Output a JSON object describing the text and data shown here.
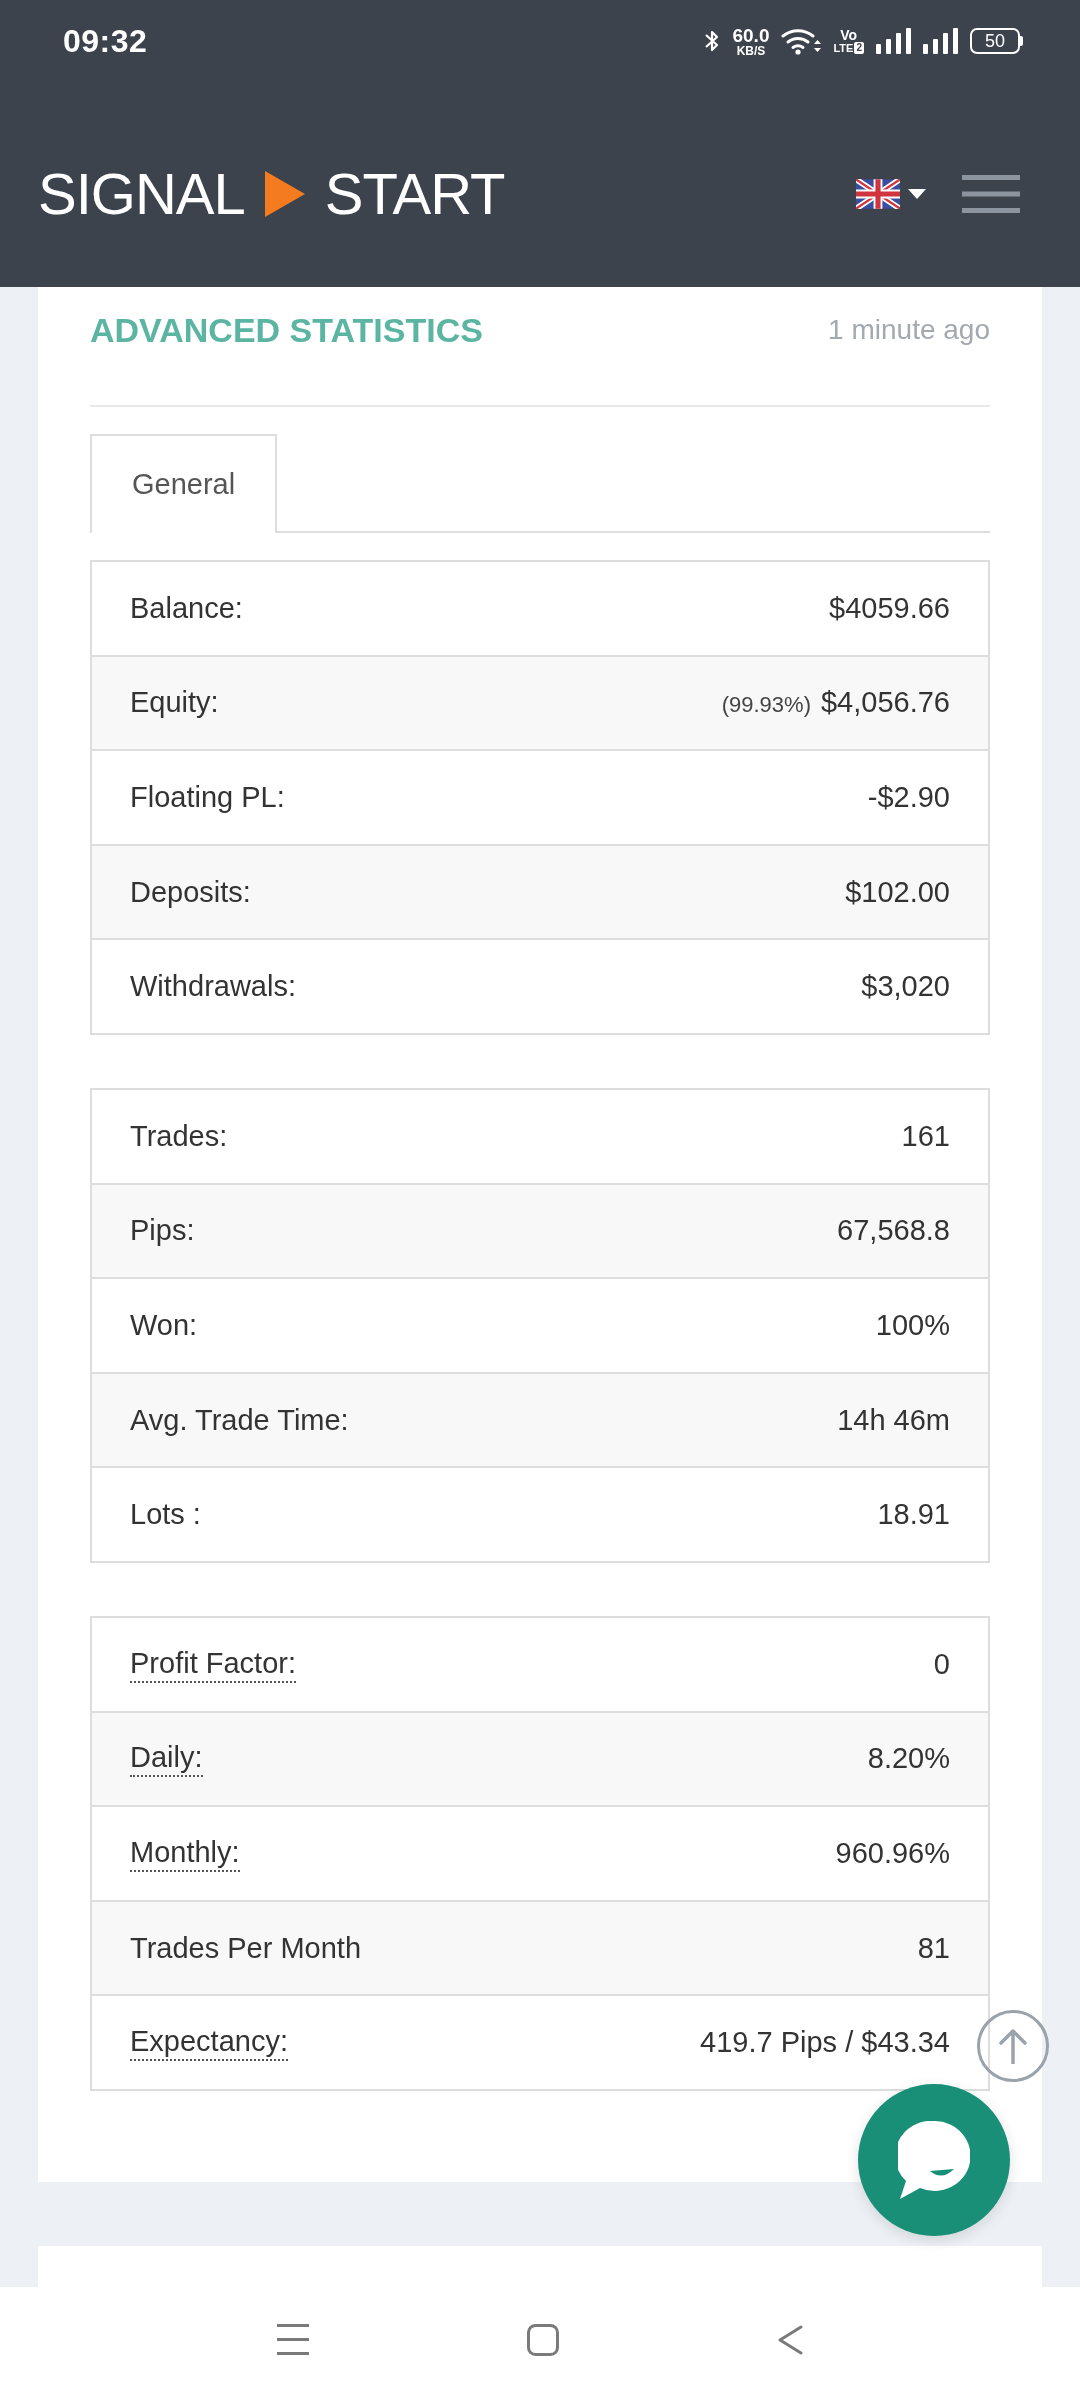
{
  "status_bar": {
    "time": "09:32",
    "network_speed": {
      "value": "60.0",
      "unit": "KB/S"
    },
    "volte": {
      "top": "Vo",
      "bottom": "LTE",
      "sim": "2"
    },
    "battery": "50"
  },
  "header": {
    "logo": {
      "left": "SIGNAL",
      "right": "START"
    }
  },
  "statistics": {
    "title": "ADVANCED STATISTICS",
    "updated": "1 minute ago",
    "tabs": [
      {
        "label": "General",
        "selected": true
      }
    ],
    "tables": [
      {
        "rows": [
          {
            "label": "Balance:",
            "value": "$4059.66",
            "has_tooltip": false
          },
          {
            "label": "Equity:",
            "note": "(99.93%)",
            "value": "$4,056.76",
            "has_tooltip": false
          },
          {
            "label": "Floating PL:",
            "value": "-$2.90",
            "has_tooltip": false
          },
          {
            "label": "Deposits:",
            "value": "$102.00",
            "has_tooltip": false
          },
          {
            "label": "Withdrawals:",
            "value": "$3,020",
            "has_tooltip": false
          }
        ]
      },
      {
        "rows": [
          {
            "label": "Trades:",
            "value": "161",
            "has_tooltip": false
          },
          {
            "label": "Pips:",
            "value": "67,568.8",
            "has_tooltip": false
          },
          {
            "label": "Won:",
            "value": "100%",
            "has_tooltip": false
          },
          {
            "label": "Avg. Trade Time:",
            "value": "14h 46m",
            "has_tooltip": false
          },
          {
            "label": "Lots :",
            "value": "18.91",
            "has_tooltip": false
          }
        ]
      },
      {
        "rows": [
          {
            "label": "Profit Factor:",
            "value": "0",
            "has_tooltip": true
          },
          {
            "label": "Daily:",
            "value": "8.20%",
            "has_tooltip": true
          },
          {
            "label": "Monthly:",
            "value": "960.96%",
            "has_tooltip": true
          },
          {
            "label": "Trades Per Month",
            "value": "81",
            "has_tooltip": false
          },
          {
            "label": "Expectancy:",
            "value": "419.7 Pips / $43.34",
            "has_tooltip": true
          }
        ]
      }
    ]
  }
}
